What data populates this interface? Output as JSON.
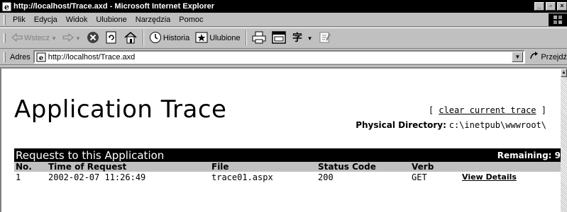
{
  "window": {
    "title": "http://localhost/Trace.axd - Microsoft Internet Explorer",
    "controls": [
      "minimize",
      "maximize",
      "close"
    ]
  },
  "menu": {
    "items": [
      "Plik",
      "Edycja",
      "Widok",
      "Ulubione",
      "Narzędzia",
      "Pomoc"
    ]
  },
  "toolbar": {
    "back_label": "Wstecz",
    "history_label": "Historia",
    "favorites_label": "Ulubione"
  },
  "address": {
    "label": "Adres",
    "url": "http://localhost/Trace.axd",
    "go_label": "Przejdź"
  },
  "page": {
    "title": "Application Trace",
    "clear_open": "[ ",
    "clear_link": "clear current trace",
    "clear_close": " ]",
    "physical_label": "Physical Directory:",
    "physical_path": "c:\\inetpub\\wwwroot\\",
    "requests_heading": "Requests to this Application",
    "remaining_label": "Remaining: 9",
    "columns": [
      "No.",
      "Time of Request",
      "File",
      "Status Code",
      "Verb"
    ],
    "rows": [
      {
        "no": "1",
        "time": "2002-02-07 11:26:49",
        "file": "trace01.aspx",
        "status": "200",
        "verb": "GET",
        "details": "View Details"
      }
    ]
  },
  "colors": {
    "chrome": "#c0c0c0",
    "title_bar": "#000000",
    "content_bg": "#ffffff"
  }
}
